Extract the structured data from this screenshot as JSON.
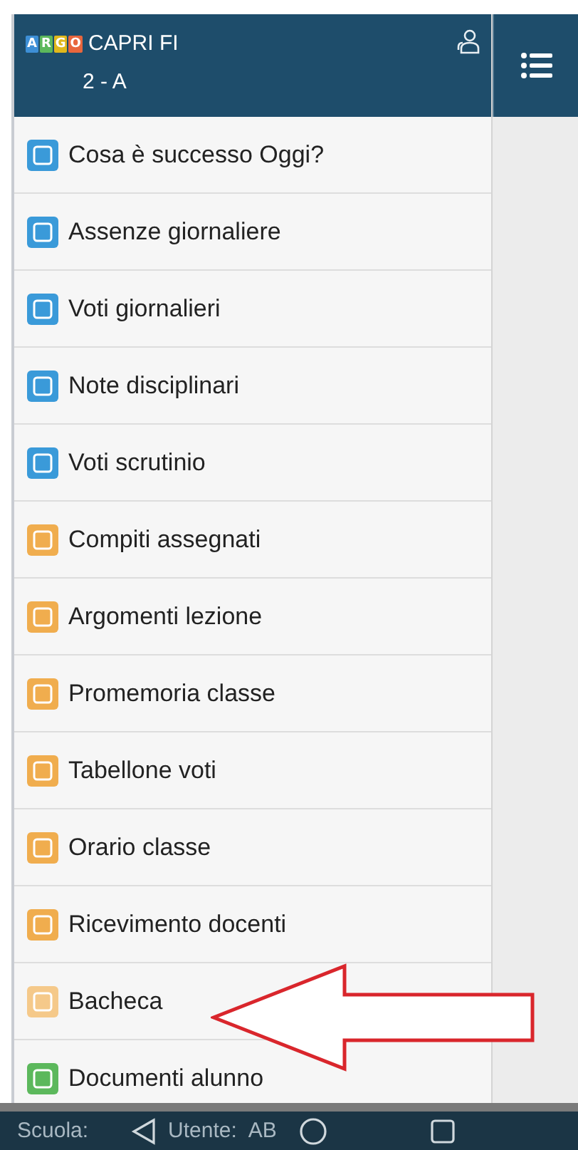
{
  "header": {
    "logo_letters": [
      {
        "text": "A",
        "color": "#3d8fd6"
      },
      {
        "text": "R",
        "color": "#5cb85c"
      },
      {
        "text": "G",
        "color": "#e0b81c"
      },
      {
        "text": "O",
        "color": "#e8663d"
      }
    ],
    "school": "CAPRI FI",
    "class": "2 - A"
  },
  "menu": [
    {
      "label": "Cosa è successo Oggi?",
      "color": "#3a9ad9"
    },
    {
      "label": "Assenze giornaliere",
      "color": "#3a9ad9"
    },
    {
      "label": "Voti giornalieri",
      "color": "#3a9ad9"
    },
    {
      "label": "Note disciplinari",
      "color": "#3a9ad9"
    },
    {
      "label": "Voti scrutinio",
      "color": "#3a9ad9"
    },
    {
      "label": "Compiti assegnati",
      "color": "#f0ad4e"
    },
    {
      "label": "Argomenti lezione",
      "color": "#f0ad4e"
    },
    {
      "label": "Promemoria classe",
      "color": "#f0ad4e"
    },
    {
      "label": "Tabellone voti",
      "color": "#f0ad4e"
    },
    {
      "label": "Orario classe",
      "color": "#f0ad4e"
    },
    {
      "label": "Ricevimento docenti",
      "color": "#f0ad4e"
    },
    {
      "label": "Bacheca",
      "color": "#f5c98a"
    },
    {
      "label": "Documenti alunno",
      "color": "#5cb85c"
    }
  ],
  "status_bar": {
    "school_label": "Scuola:",
    "user_label": "Utente:",
    "user_value": "AB"
  }
}
